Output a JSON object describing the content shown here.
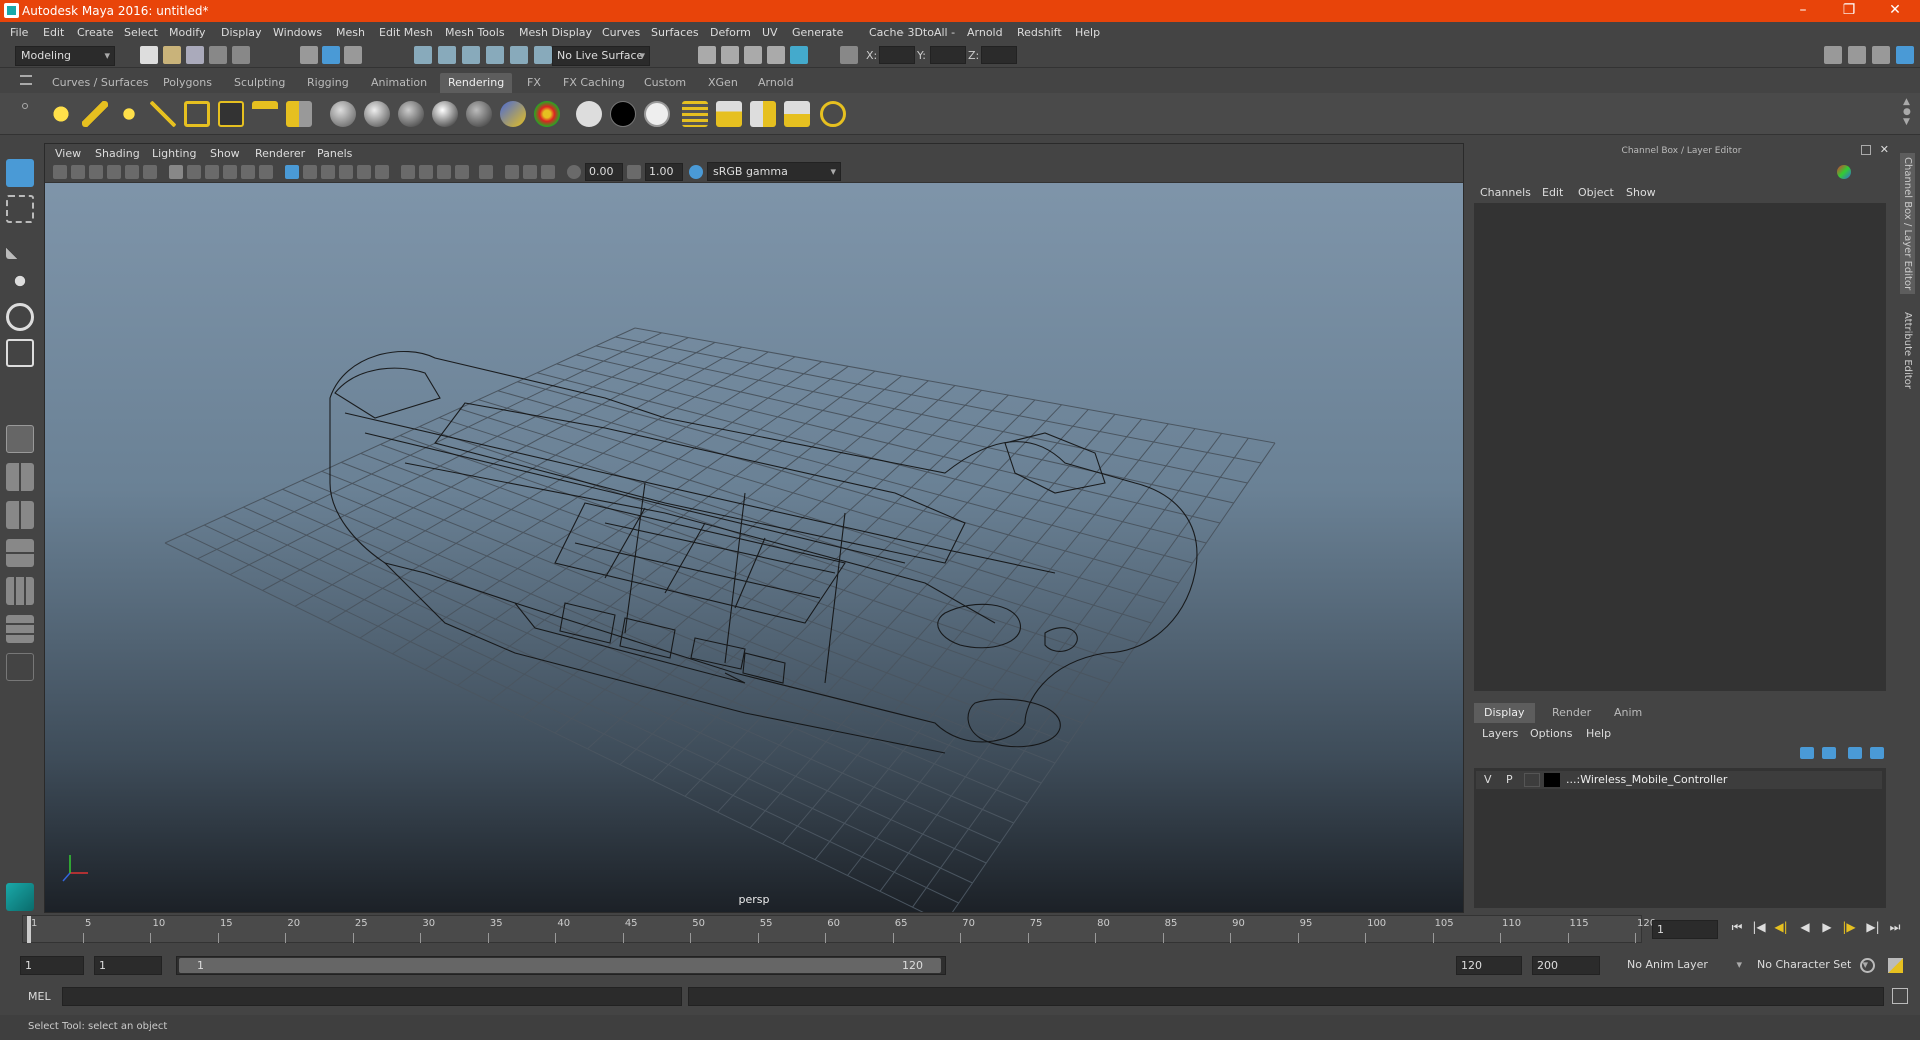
{
  "window": {
    "title": "Autodesk Maya 2016: untitled*",
    "minimize": "–",
    "restore": "❐",
    "close": "✕"
  },
  "menu": [
    "File",
    "Edit",
    "Create",
    "Select",
    "Modify",
    "Display",
    "Windows",
    "Mesh",
    "Edit Mesh",
    "Mesh Tools",
    "Mesh Display",
    "Curves",
    "Surfaces",
    "Deform",
    "UV",
    "Generate",
    "Cache",
    "- 3DtoAll -",
    "Arnold",
    "Redshift",
    "Help"
  ],
  "status": {
    "mode": "Modeling",
    "live_surface": "No Live Surface",
    "x_label": "X:",
    "y_label": "Y:",
    "z_label": "Z:"
  },
  "shelf_tabs": [
    "Curves / Surfaces",
    "Polygons",
    "Sculpting",
    "Rigging",
    "Animation",
    "Rendering",
    "FX",
    "FX Caching",
    "Custom",
    "XGen",
    "Arnold"
  ],
  "shelf_active": "Rendering",
  "viewport": {
    "menu": [
      "View",
      "Shading",
      "Lighting",
      "Show",
      "Renderer",
      "Panels"
    ],
    "exposure": "0.00",
    "gamma": "1.00",
    "color_space": "sRGB gamma",
    "camera": "persp"
  },
  "channel_box": {
    "title": "Channel Box / Layer Editor",
    "menu": [
      "Channels",
      "Edit",
      "Object",
      "Show"
    ],
    "layer_tabs": [
      "Display",
      "Render",
      "Anim"
    ],
    "layer_menu": [
      "Layers",
      "Options",
      "Help"
    ],
    "layer": {
      "v": "V",
      "p": "P",
      "name": "...:Wireless_Mobile_Controller"
    }
  },
  "side_tabs": [
    "Channel Box / Layer Editor",
    "Attribute Editor"
  ],
  "timeline": {
    "ticks": [
      "1",
      "5",
      "10",
      "15",
      "20",
      "25",
      "30",
      "35",
      "40",
      "45",
      "50",
      "55",
      "60",
      "65",
      "70",
      "75",
      "80",
      "85",
      "90",
      "95",
      "100",
      "105",
      "110",
      "115",
      "120"
    ],
    "current_frame": "1"
  },
  "range": {
    "start": "1",
    "anim_start": "1",
    "range_start": "1",
    "range_end": "120",
    "end": "120",
    "anim_end": "200",
    "anim_layer": "No Anim Layer",
    "char_set": "No Character Set"
  },
  "cmd": {
    "label": "MEL"
  },
  "help": "Select Tool: select an object",
  "colors": {
    "title_bar": "#e8440a",
    "shelf_tab_active": "#5d5d5d",
    "accent": "#4a9ad6"
  }
}
